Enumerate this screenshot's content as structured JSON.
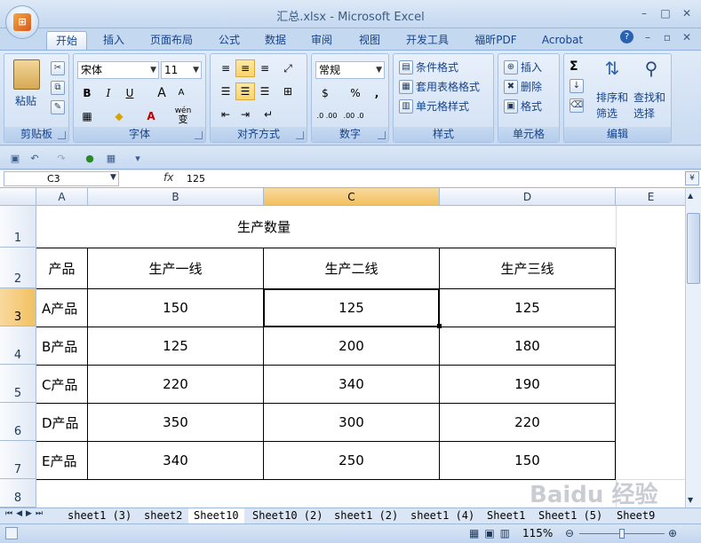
{
  "app": {
    "title": "汇总.xlsx - Microsoft Excel",
    "orb_label": "Office",
    "window_controls": {
      "min": "–",
      "max": "□",
      "close": "✕"
    },
    "doc_controls": {
      "help": "?",
      "min": "–",
      "restore": "▫",
      "close": "✕"
    }
  },
  "tabs": [
    "开始",
    "插入",
    "页面布局",
    "公式",
    "数据",
    "审阅",
    "视图",
    "开发工具",
    "福昕PDF",
    "Acrobat"
  ],
  "active_tab": "开始",
  "ribbon": {
    "clipboard": {
      "label": "剪贴板",
      "paste": "粘贴"
    },
    "font": {
      "label": "字体",
      "name": "宋体",
      "size": "11",
      "bold": "B",
      "italic": "I",
      "underline": "U",
      "grow": "A",
      "shrink": "A",
      "wen": "wén",
      "wen_char": "变"
    },
    "alignment": {
      "label": "对齐方式"
    },
    "number": {
      "label": "数字",
      "format": "常规",
      "percent": "%",
      "comma": ",",
      "inc": ".0 .00",
      "dec": ".00 .0"
    },
    "styles": {
      "label": "样式",
      "conditional": "条件格式",
      "table": "套用表格格式",
      "cell_styles": "单元格样式"
    },
    "cells": {
      "label": "单元格",
      "insert": "插入",
      "delete": "删除",
      "format": "格式"
    },
    "editing": {
      "label": "编辑",
      "sigma": "Σ",
      "sort": "排序和",
      "sort2": "筛选",
      "find": "查找和",
      "find2": "选择"
    }
  },
  "formula_bar": {
    "name_box": "C3",
    "fx": "fx",
    "value": "125"
  },
  "columns": [
    "A",
    "B",
    "C",
    "D",
    "E"
  ],
  "rows": [
    "1",
    "2",
    "3",
    "4",
    "5",
    "6",
    "7",
    "8"
  ],
  "sheet": {
    "title": "生产数量",
    "headers": [
      "产品",
      "生产一线",
      "生产二线",
      "生产三线"
    ],
    "data": [
      [
        "A产品",
        "150",
        "125",
        "125"
      ],
      [
        "B产品",
        "125",
        "200",
        "180"
      ],
      [
        "C产品",
        "220",
        "340",
        "190"
      ],
      [
        "D产品",
        "350",
        "300",
        "220"
      ],
      [
        "E产品",
        "340",
        "250",
        "150"
      ]
    ]
  },
  "sheet_tabs": [
    "sheet1 (3)",
    "sheet2",
    "Sheet10",
    "Sheet10 (2)",
    "sheet1 (2)",
    "sheet1 (4)",
    "Sheet1",
    "Sheet1 (5)",
    "Sheet9"
  ],
  "active_sheet": "Sheet10",
  "status": {
    "zoom": "115%"
  },
  "watermark": "Baidu 经验"
}
